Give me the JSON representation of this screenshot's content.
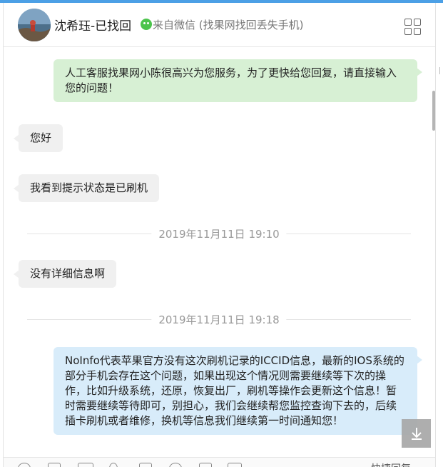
{
  "header": {
    "contact_name": "沈希珏-已找回",
    "source_label": "来自微信 (找果网找回丢失手机)",
    "icons": {
      "avatar": "avatar",
      "wechat": "wechat-icon",
      "apps": "grid-apps-icon"
    }
  },
  "messages": [
    {
      "side": "out",
      "text": "人工客服找果网小陈很高兴为您服务，为了更快给您回复，请直接输入您的问题！"
    },
    {
      "side": "in",
      "text": "您好"
    },
    {
      "side": "in",
      "text": "我看到提示状态是已刷机"
    },
    {
      "side": "time",
      "text": "2019年11月11日 19:10"
    },
    {
      "side": "in",
      "text": "没有详细信息啊"
    },
    {
      "side": "time",
      "text": "2019年11月11日 19:18"
    },
    {
      "side": "out-blue",
      "text": "NoInfo代表苹果官方没有这次刷机记录的ICCID信息，最新的IOS系统的部分手机会存在这个问题，如果出现这个情况则需要继续等下次的操作，比如升级系统，还原，恢复出厂，刷机等操作会更新这个信息！暂时需要继续等待即可，别担心，我们会继续帮您监控查询下去的，后续插卡刷机或者维修，换机等信息我们继续第一时间通知您！"
    }
  ],
  "toolbar": {
    "icons": [
      "emoji-icon",
      "screenshot-icon",
      "video-icon",
      "microphone-icon",
      "image-icon",
      "location-icon",
      "settings-icon",
      "photo-icon"
    ],
    "quick_reply_label": "快捷回复"
  },
  "download_button": {
    "icon": "download-icon"
  }
}
